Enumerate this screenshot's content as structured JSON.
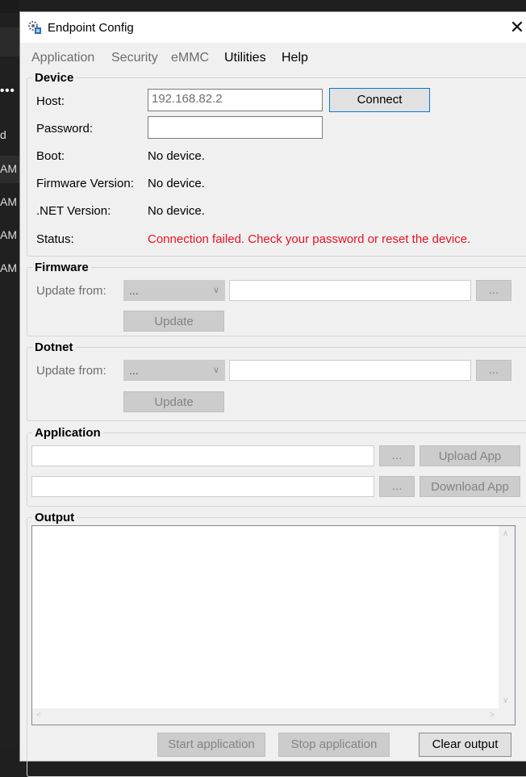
{
  "background_app": {
    "dots": "•••",
    "items": [
      "d",
      "AM",
      "AM",
      "AM",
      "AM"
    ]
  },
  "window": {
    "title": "Endpoint Config",
    "icon": "app-config-icon",
    "close_glyph": "✕"
  },
  "menu": {
    "application": "Application",
    "security": "Security",
    "emmc": "eMMC",
    "utilities": "Utilities",
    "help": "Help"
  },
  "device": {
    "title": "Device",
    "host_label": "Host:",
    "host_value": "192.168.82.2",
    "connect": "Connect",
    "password_label": "Password:",
    "password_value": "",
    "boot_label": "Boot:",
    "boot_value": "No device.",
    "firmware_label": "Firmware Version:",
    "firmware_value": "No device.",
    "dotnet_label": ".NET Version:",
    "dotnet_value": "No device.",
    "status_label": "Status:",
    "status_value": "Connection failed. Check your password or reset the device.",
    "status_color": "#e81123"
  },
  "firmware": {
    "title": "Firmware",
    "update_from_label": "Update from:",
    "source_value": "...",
    "path_value": "",
    "browse": "...",
    "update": "Update"
  },
  "dotnet": {
    "title": "Dotnet",
    "update_from_label": "Update from:",
    "source_value": "...",
    "path_value": "",
    "browse": "...",
    "update": "Update"
  },
  "application": {
    "title": "Application",
    "upload_path": "",
    "upload_browse": "...",
    "upload_button": "Upload App",
    "download_path": "",
    "download_browse": "...",
    "download_button": "Download App"
  },
  "output": {
    "title": "Output",
    "text": "",
    "start_button": "Start application",
    "stop_button": "Stop application",
    "clear_button": "Clear output"
  }
}
